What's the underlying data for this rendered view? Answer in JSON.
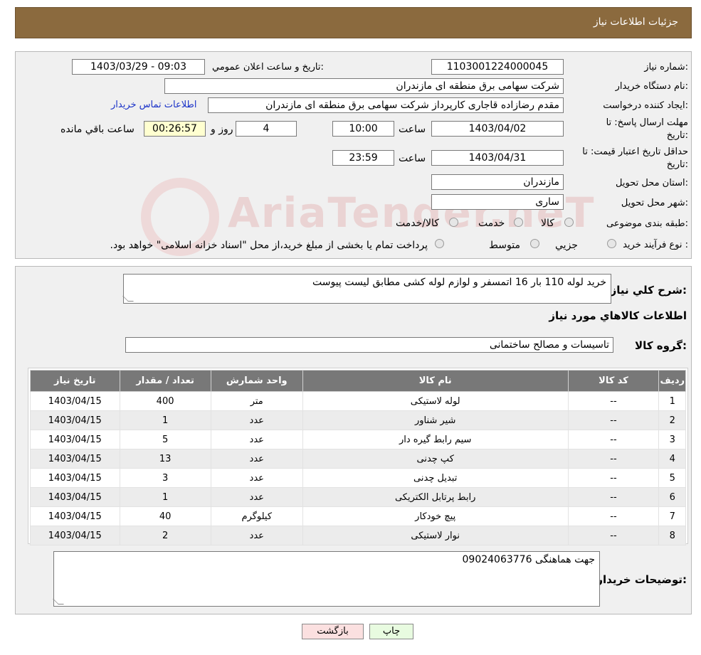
{
  "header": {
    "title": "جزئیات اطلاعات نیاز"
  },
  "form": {
    "need_number": {
      "label": "شماره نیاز:",
      "value": "1103001224000045"
    },
    "announce": {
      "label": "تاریخ و ساعت اعلان عمومي:",
      "value": "1403/03/29 - 09:03"
    },
    "buyer_org": {
      "label": "نام دستگاه خريدار:",
      "value": "شرکت سهامی برق منطقه ای مازندران"
    },
    "requester": {
      "label": "ایجاد کننده درخواست:",
      "value": "مقدم رضازاده قاجاری کارپرداز شرکت سهامی برق منطقه ای مازندران",
      "contact_link": "اطلاعات تماس خریدار"
    },
    "reply_deadline": {
      "label_line1": "مهلت ارسال پاسخ: تا",
      "label_line2": "تاریخ:",
      "date": "1403/04/02",
      "time_label": "ساعت",
      "time": "10:00",
      "days": "4",
      "days_label": "روز و",
      "remaining": "00:26:57",
      "remaining_label": "ساعت باقي مانده"
    },
    "price_validity": {
      "label_line1": "حداقل تاریخ اعتبار قیمت: تا",
      "label_line2": "تاریخ:",
      "date": "1403/04/31",
      "time_label": "ساعت",
      "time": "23:59"
    },
    "province": {
      "label": "استان محل تحویل:",
      "value": "مازندران"
    },
    "city": {
      "label": "شهر محل تحویل:",
      "value": "ساری"
    },
    "category": {
      "label": "طبقه بندی موضوعی:",
      "options": [
        "کالا",
        "خدمت",
        "کالا/خدمت"
      ]
    },
    "process": {
      "label": "نوع فرآیند خرید :",
      "options": [
        "جزيي",
        "متوسط"
      ],
      "note": "پرداخت تمام یا بخشی از مبلغ خرید،از محل \"اسناد خزانه اسلامی\" خواهد بود."
    }
  },
  "watermark": {
    "text": "AriaTender.neT"
  },
  "summary": {
    "label": "شرح كلي نياز:",
    "value": "خرید لوله 110 بار 16 اتمسفر و لوازم لوله کشی مطابق لیست پیوست"
  },
  "goods_section": {
    "title": "اطلاعات كالاهاي مورد نياز"
  },
  "goods_group": {
    "label": "گروه کالا:",
    "value": "تاسیسات و مصالح ساختمانی"
  },
  "table": {
    "headers": [
      "رديف",
      "کد کالا",
      "نام کالا",
      "واحد شمارش",
      "تعداد / مقدار",
      "تاریخ نیاز"
    ],
    "rows": [
      [
        "1",
        "--",
        "لوله لاستیکی",
        "متر",
        "400",
        "1403/04/15"
      ],
      [
        "2",
        "--",
        "شیر شناور",
        "عدد",
        "1",
        "1403/04/15"
      ],
      [
        "3",
        "--",
        "سیم رابط گیره دار",
        "عدد",
        "5",
        "1403/04/15"
      ],
      [
        "4",
        "--",
        "کپ چدنی",
        "عدد",
        "13",
        "1403/04/15"
      ],
      [
        "5",
        "--",
        "تبدیل چدنی",
        "عدد",
        "3",
        "1403/04/15"
      ],
      [
        "6",
        "--",
        "رابط پرتابل الکتریکی",
        "عدد",
        "1",
        "1403/04/15"
      ],
      [
        "7",
        "--",
        "پیچ خودکار",
        "کیلوگرم",
        "40",
        "1403/04/15"
      ],
      [
        "8",
        "--",
        "نوار لاستیکی",
        "عدد",
        "2",
        "1403/04/15"
      ]
    ]
  },
  "buyer_notes": {
    "label": "توضیحات خریدار:",
    "value": "09024063776 جهت هماهنگی"
  },
  "buttons": {
    "print": "چاپ",
    "back": "بازگشت"
  },
  "colors": {
    "header_bg": "#8b6a3e",
    "table_header_bg": "#787878",
    "link": "#1a32c8",
    "print_btn": "#e8fbe0",
    "back_btn": "#fbe0e0"
  }
}
